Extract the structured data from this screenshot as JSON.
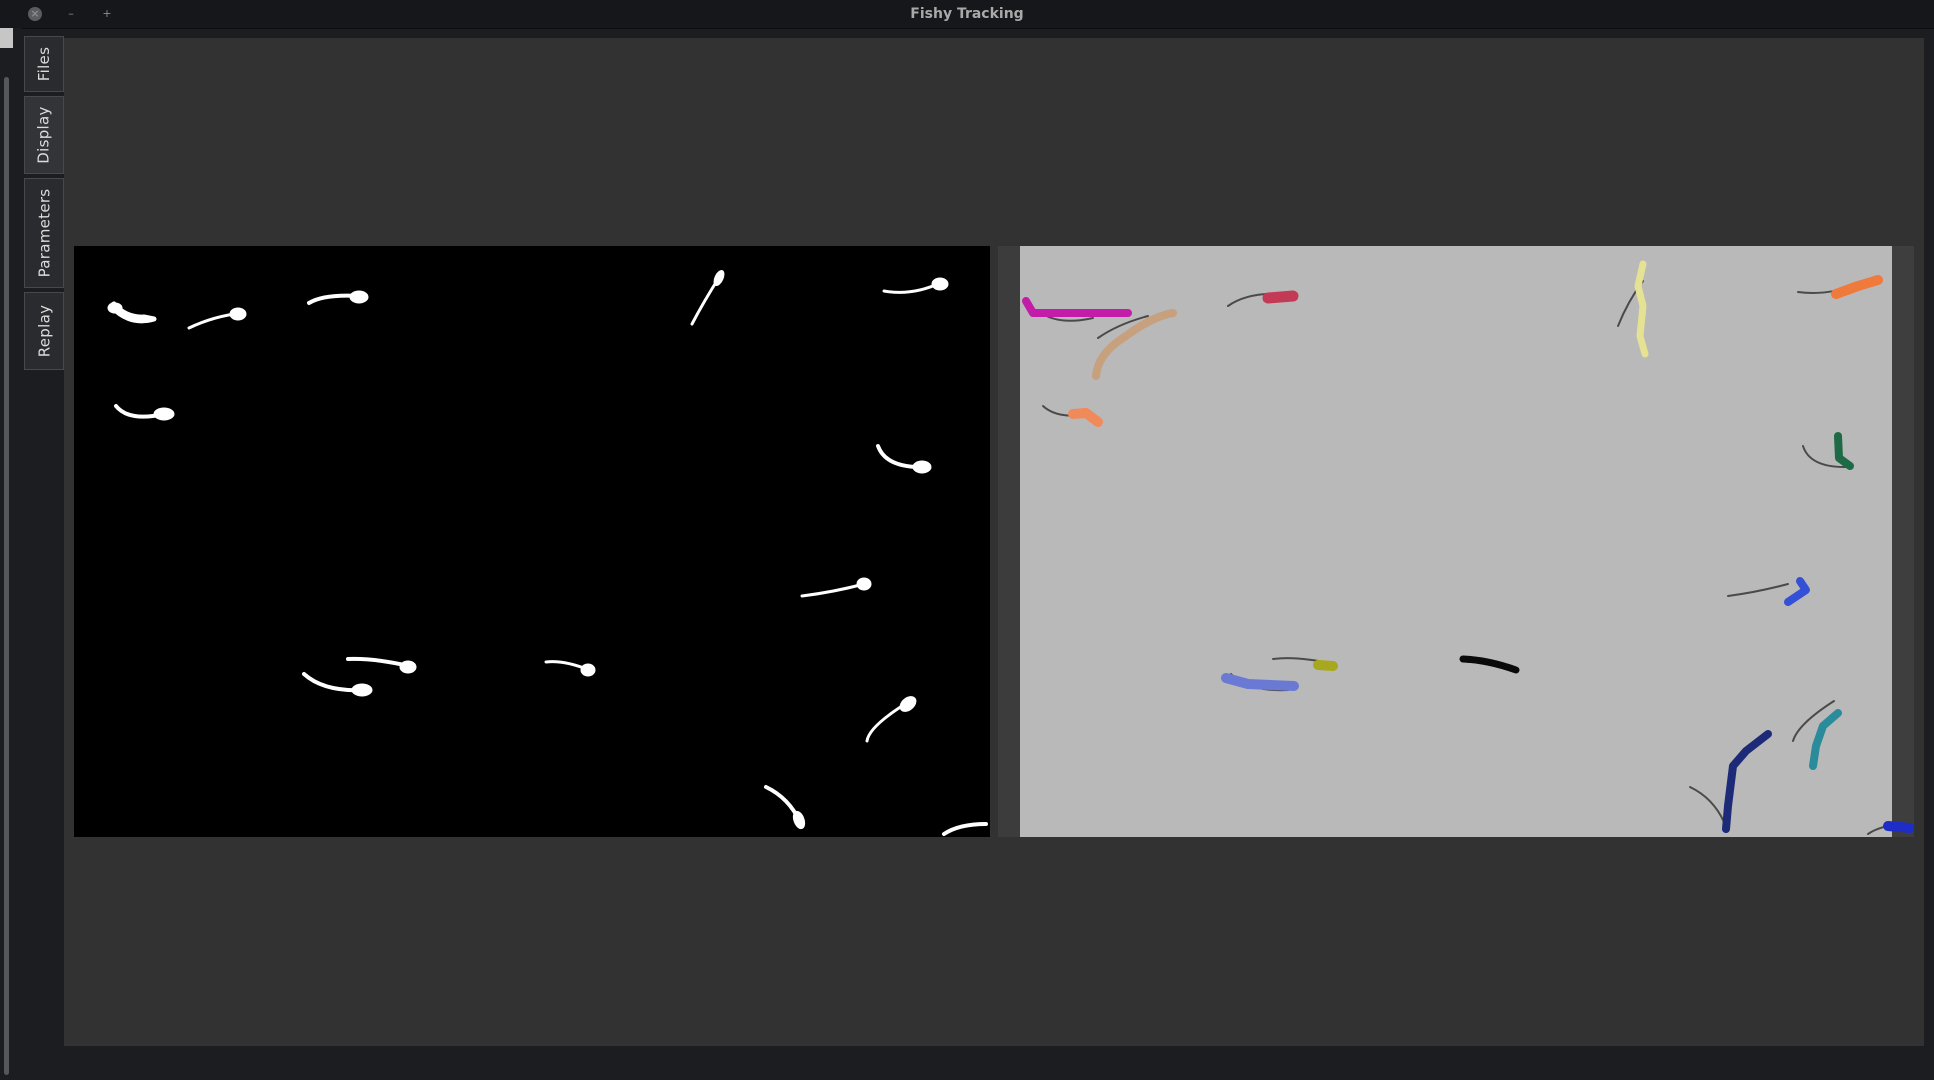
{
  "window": {
    "title": "Fishy Tracking",
    "controls": {
      "close": "×",
      "minimize": "–",
      "maximize": "+"
    }
  },
  "sidebar": {
    "tabs": [
      {
        "label": "Files"
      },
      {
        "label": "Display"
      },
      {
        "label": "Parameters"
      },
      {
        "label": "Replay"
      }
    ],
    "active_tab": "Display"
  },
  "views": [
    {
      "name": "binary-mask-view",
      "content": "thresholded fish silhouettes (white on black)"
    },
    {
      "name": "tracking-view",
      "content": "grayscale tank frame with colored fish trajectories"
    }
  ],
  "trajectory_colors": [
    "#c21ca8",
    "#c7a07d",
    "#c23a55",
    "#e6e294",
    "#f07a3c",
    "#f08a5a",
    "#1e6a46",
    "#3350d6",
    "#a8a81e",
    "#0a0a0a",
    "#6a7ad4",
    "#1c2a78",
    "#2a8c9a",
    "#1e2cc8"
  ],
  "colors": {
    "window_bg": "#1c1d20",
    "panel_bg": "#323232",
    "tab_bg": "#2a2b2f",
    "tank_bg": "#b8b8b8"
  }
}
